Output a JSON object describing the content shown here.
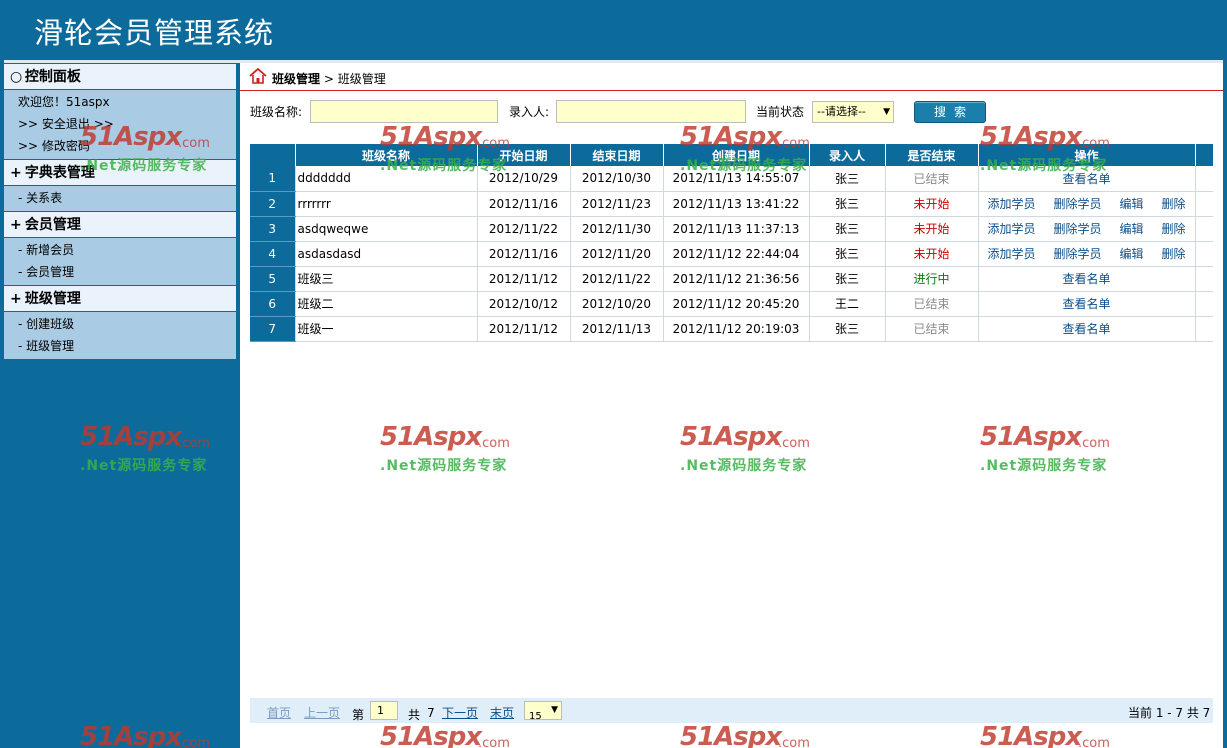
{
  "app": {
    "title": "滑轮会员管理系统"
  },
  "sidebar": {
    "groups": [
      {
        "marker": "○",
        "title": "控制面板",
        "items": [
          "欢迎您！51aspx",
          ">> 安全退出  >>",
          ">> 修改密码"
        ]
      },
      {
        "marker": "+",
        "title": "字典表管理",
        "items": [
          "- 关系表"
        ]
      },
      {
        "marker": "+",
        "title": "会员管理",
        "items": [
          "- 新增会员",
          "- 会员管理"
        ]
      },
      {
        "marker": "+",
        "title": "班级管理",
        "items": [
          "- 创建班级",
          "- 班级管理"
        ]
      }
    ]
  },
  "breadcrumb": {
    "parent": "班级管理",
    "sep": " > ",
    "current": "班级管理"
  },
  "search": {
    "class_name_label": "班级名称:",
    "class_name_value": "",
    "recorder_label": "录入人:",
    "recorder_value": "",
    "status_label": "当前状态",
    "status_selected": "--请选择--",
    "search_button": "搜索"
  },
  "table": {
    "headers": [
      "",
      "班级名称",
      "开始日期",
      "结束日期",
      "创建日期",
      "录入人",
      "是否结束",
      "操作"
    ],
    "rows": [
      {
        "num": "1",
        "name": "ddddddd",
        "start": "2012/10/29",
        "end": "2012/10/30",
        "created": "2012/11/13 14:55:07",
        "recorder": "张三",
        "status": "已结束",
        "status_kind": "done",
        "ops": [
          "查看名单"
        ]
      },
      {
        "num": "2",
        "name": "rrrrrrr",
        "start": "2012/11/16",
        "end": "2012/11/23",
        "created": "2012/11/13 13:41:22",
        "recorder": "张三",
        "status": "未开始",
        "status_kind": "todo",
        "ops": [
          "添加学员",
          "删除学员",
          "编辑",
          "删除"
        ]
      },
      {
        "num": "3",
        "name": "asdqweqwe",
        "start": "2012/11/22",
        "end": "2012/11/30",
        "created": "2012/11/13 11:37:13",
        "recorder": "张三",
        "status": "未开始",
        "status_kind": "todo",
        "ops": [
          "添加学员",
          "删除学员",
          "编辑",
          "删除"
        ]
      },
      {
        "num": "4",
        "name": "asdasdasd",
        "start": "2012/11/16",
        "end": "2012/11/20",
        "created": "2012/11/12 22:44:04",
        "recorder": "张三",
        "status": "未开始",
        "status_kind": "todo",
        "ops": [
          "添加学员",
          "删除学员",
          "编辑",
          "删除"
        ]
      },
      {
        "num": "5",
        "name": "班级三",
        "start": "2012/11/12",
        "end": "2012/11/22",
        "created": "2012/11/12 21:36:56",
        "recorder": "张三",
        "status": "进行中",
        "status_kind": "run",
        "ops": [
          "查看名单"
        ]
      },
      {
        "num": "6",
        "name": "班级二",
        "start": "2012/10/12",
        "end": "2012/10/20",
        "created": "2012/11/12 20:45:20",
        "recorder": "王二",
        "status": "已结束",
        "status_kind": "done",
        "ops": [
          "查看名单"
        ]
      },
      {
        "num": "7",
        "name": "班级一",
        "start": "2012/11/12",
        "end": "2012/11/13",
        "created": "2012/11/12 20:19:03",
        "recorder": "张三",
        "status": "已结束",
        "status_kind": "done",
        "ops": [
          "查看名单"
        ]
      }
    ]
  },
  "pager": {
    "first": "首页",
    "prev": "上一页",
    "page_prefix": "第",
    "page_value": "1",
    "total_prefix": "共",
    "total_pages": "7",
    "next": "下一页",
    "last": "末页",
    "page_size": "15",
    "summary": "当前  1 - 7 共  7"
  },
  "watermark": {
    "brand": "51Aspx",
    "domain": ".com",
    "slogan": ".Net源码服务专家"
  },
  "colors": {
    "primary": "#0c6b9a",
    "accent_red": "#cc0000",
    "accent_green": "#0a7a0a",
    "input_bg": "#ffffcc"
  }
}
